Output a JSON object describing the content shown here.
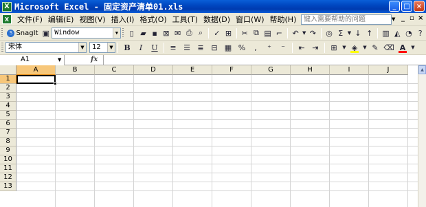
{
  "window": {
    "title": "Microsoft Excel - 固定资产清单01.xls",
    "app_icon": "X",
    "controls": {
      "minimize": "_",
      "maximize": "□",
      "close": "×"
    }
  },
  "menubar": {
    "items": [
      "文件(F)",
      "编辑(E)",
      "视图(V)",
      "插入(I)",
      "格式(O)",
      "工具(T)",
      "数据(D)",
      "窗口(W)",
      "帮助(H)"
    ],
    "help_placeholder": "键入需要帮助的问题",
    "doc_controls": {
      "minimize": "_",
      "restore": "▫",
      "close": "×"
    }
  },
  "toolbar1": {
    "snagit_label": "SnagIt",
    "window_combo_value": "Window"
  },
  "toolbar2": {
    "font_name": "宋体",
    "font_size": "12",
    "bold": "B",
    "italic": "I",
    "underline": "U",
    "percent": "%",
    "comma": ","
  },
  "formula_bar": {
    "name_box": "A1",
    "fx_label": "fx",
    "formula": ""
  },
  "sheet": {
    "columns": [
      "A",
      "B",
      "C",
      "D",
      "E",
      "F",
      "G",
      "H",
      "I",
      "J"
    ],
    "rows": [
      "1",
      "2",
      "3",
      "4",
      "5",
      "6",
      "7",
      "8",
      "9",
      "10",
      "11",
      "12",
      "13"
    ],
    "active_cell": "A1"
  },
  "colors": {
    "title_blue": "#0047c0",
    "chrome": "#ece9d8",
    "active_header": "#f7c77a",
    "highlight_yellow": "#ffff00",
    "font_red": "#ff0000"
  }
}
